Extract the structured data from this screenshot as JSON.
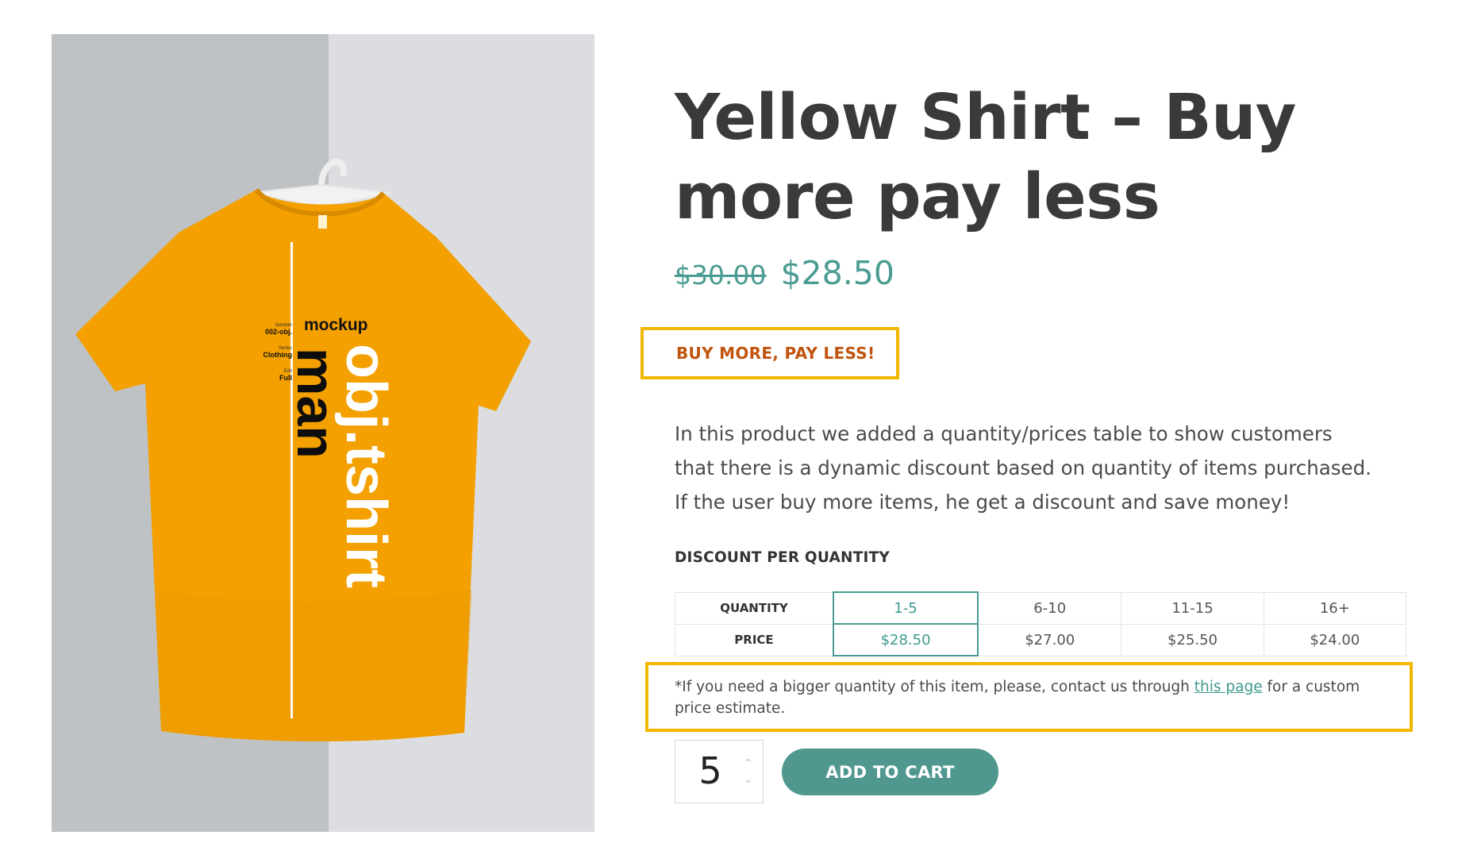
{
  "product": {
    "image_alt": "Yellow t-shirt mockup on hanger",
    "image_text": {
      "mockup": "mockup",
      "vertical_black": "man",
      "vertical_white": "obj.tshirt",
      "spec_number_label": "Number",
      "spec_number_value": "002-obj.",
      "spec_series_label": "Series",
      "spec_series_value": "Clothing",
      "spec_edit_label": "Edit",
      "spec_edit_value": "Full"
    },
    "title": "Yellow Shirt – Buy more pay less",
    "price_old": "$30.00",
    "price_new": "$28.50",
    "promo_label": "BUY MORE, PAY LESS!",
    "description": "In this product we added a quantity/prices table to show customers that there is a dynamic discount based on quantity of items purchased. If the user buy more items, he get a discount and save money!",
    "discount_heading": "DISCOUNT PER QUANTITY"
  },
  "discount_table": {
    "quantity_label": "QUANTITY",
    "price_label": "PRICE",
    "tiers": [
      {
        "range": "1-5",
        "price": "$28.50",
        "selected": true
      },
      {
        "range": "6-10",
        "price": "$27.00",
        "selected": false
      },
      {
        "range": "11-15",
        "price": "$25.50",
        "selected": false
      },
      {
        "range": "16+",
        "price": "$24.00",
        "selected": false
      }
    ]
  },
  "note": {
    "before": "*If you need a bigger quantity of this item, please, contact us through ",
    "link": "this page",
    "after": " for a custom price estimate."
  },
  "cart": {
    "quantity": "5",
    "button_label": "ADD TO CART"
  },
  "colors": {
    "accent": "#4a9b92",
    "highlight_border": "#f3b700",
    "promo_text": "#c0540d",
    "shirt": "#f3a000"
  }
}
